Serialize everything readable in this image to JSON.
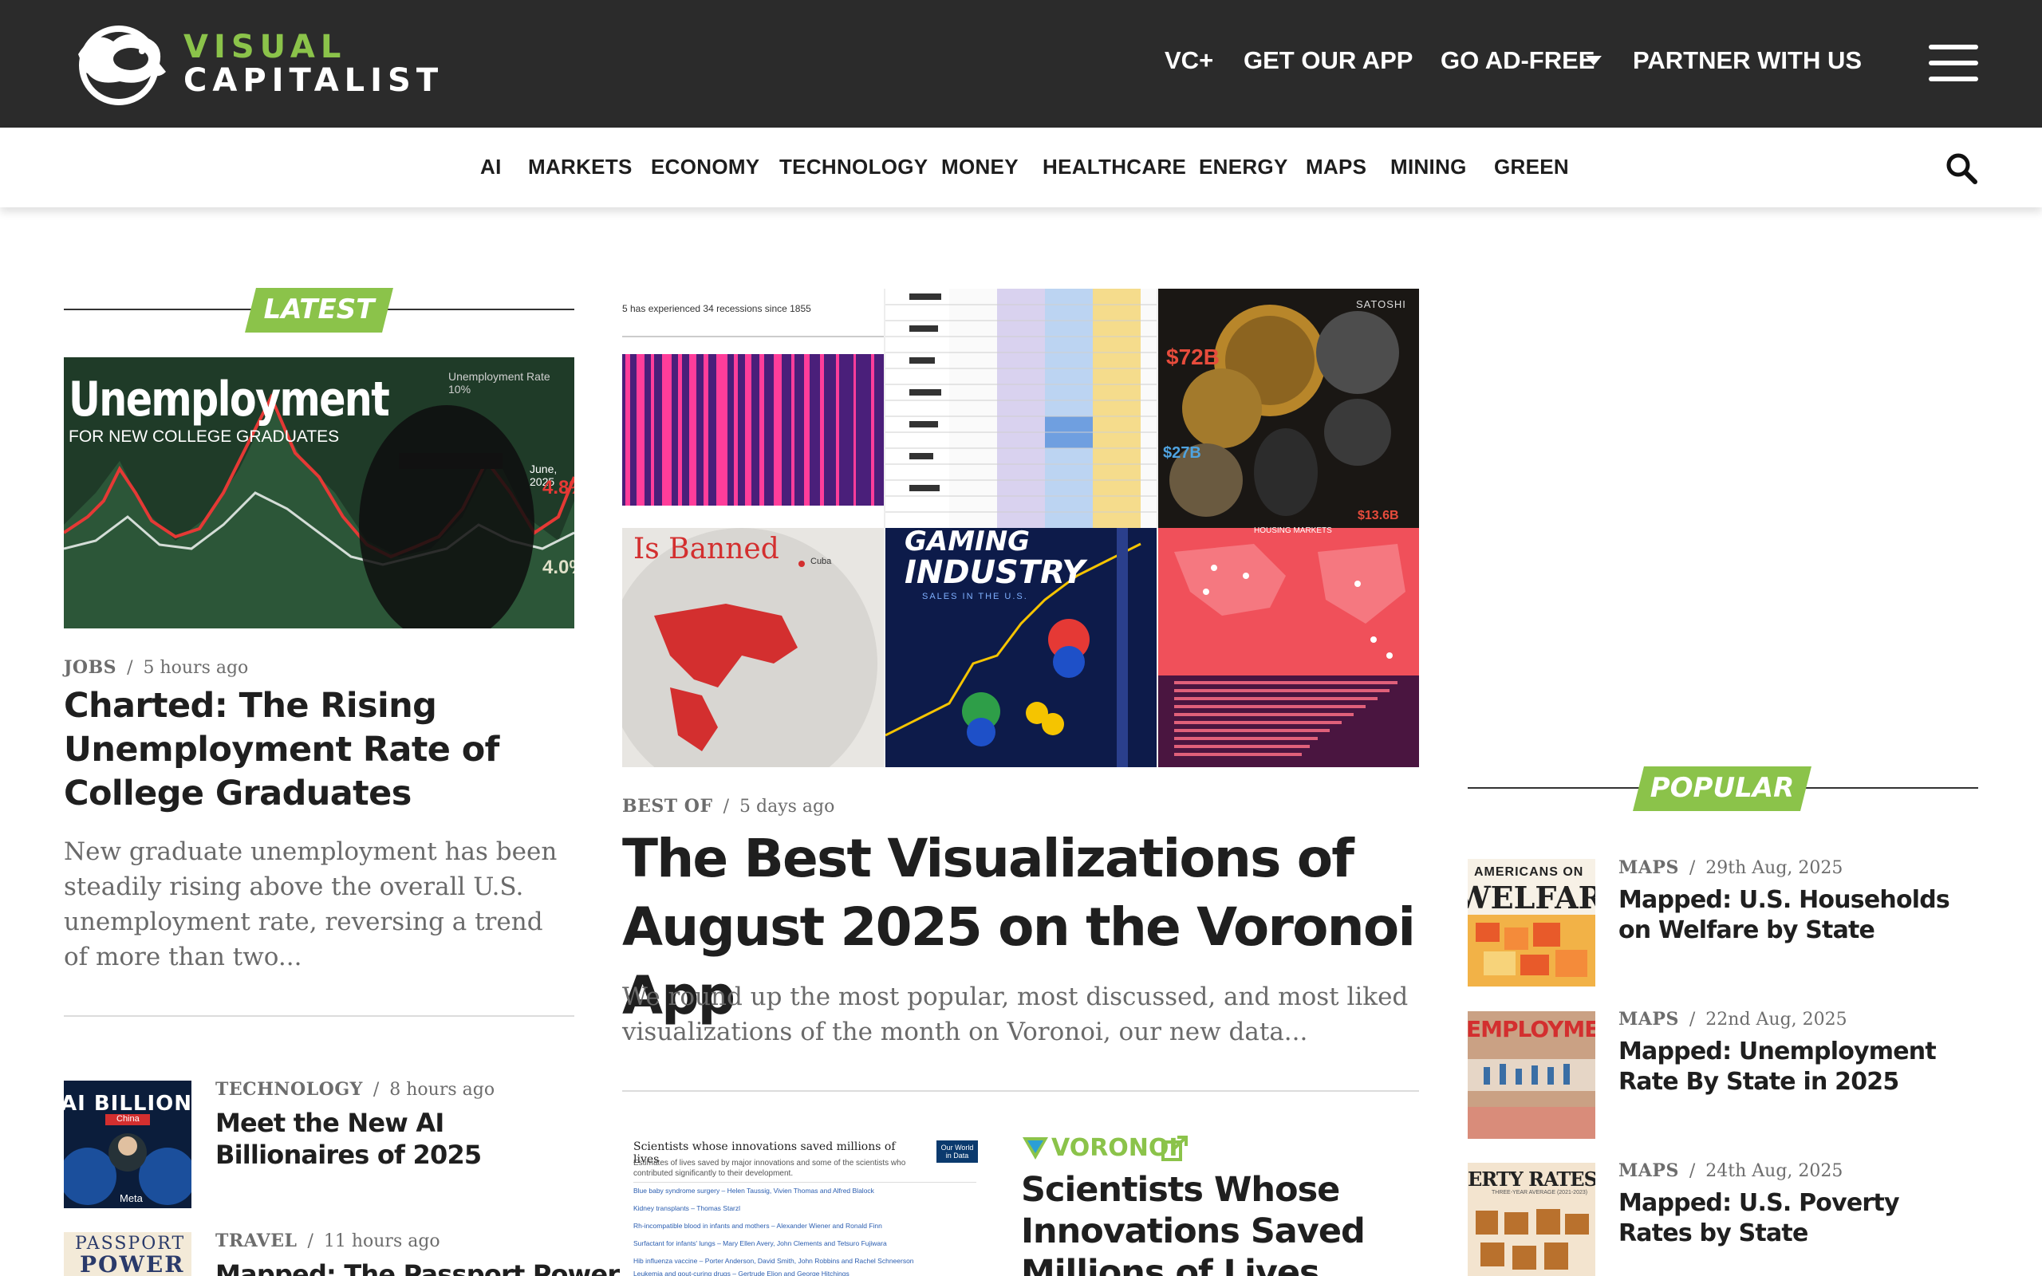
{
  "header": {
    "logo_top": "VISUAL",
    "logo_bottom": "CAPITALIST",
    "nav": [
      {
        "label": "VC+"
      },
      {
        "label": "GET OUR APP"
      },
      {
        "label": "GO AD-FREE"
      },
      {
        "label": "PARTNER WITH US"
      }
    ]
  },
  "categories": [
    "AI",
    "MARKETS",
    "ECONOMY",
    "TECHNOLOGY",
    "MONEY",
    "HEALTHCARE",
    "ENERGY",
    "MAPS",
    "MINING",
    "GREEN"
  ],
  "latest": {
    "label": "LATEST",
    "featured": {
      "image_title": "Unemployment",
      "image_subtitle": "FOR NEW COLLEGE GRADUATES",
      "image_legend": "Unemployment Rate 10%",
      "image_date": "June, 2025",
      "image_value_high": "4.8%",
      "image_value_low": "4.0%",
      "category": "JOBS",
      "time": "5 hours ago",
      "title": "Charted: The Rising Unemployment Rate of College Graduates",
      "excerpt": "New graduate unemployment has been steadily rising above the overall U.S. unemployment rate, reversing a trend of more than two..."
    },
    "items": [
      {
        "category": "TECHNOLOGY",
        "time": "8 hours ago",
        "title": "Meet the New AI Billionaires of 2025",
        "thumb_text": "AI BILLIONAIRE",
        "thumb_text2": "China",
        "thumb_text3": "Meta"
      },
      {
        "category": "TRAVEL",
        "time": "11 hours ago",
        "title": "Mapped: The Passport Power of",
        "thumb_text": "PASSPORT",
        "thumb_text2": "POWER"
      }
    ]
  },
  "main": {
    "collage": {
      "tile1_caption": "5 has experienced 34 recessions since 1855",
      "tile3_label": "SATOSHI",
      "tile3_value1": "$72B",
      "tile3_value2": "$27B",
      "tile3_value3": "$13.6B",
      "tile4_title": "Is Banned",
      "tile4_country": "Cuba",
      "tile5_title1": "GAMING",
      "tile5_title2": "INDUSTRY",
      "tile5_sub": "SALES IN THE U.S.",
      "tile6_title": "HOUSING MARKETS"
    },
    "category": "BEST OF",
    "time": "5 days ago",
    "title": "The Best Visualizations of August 2025 on the Voronoi App",
    "excerpt": "We round up the most popular, most discussed, and most liked visualizations of the month on Voronoi, our new data...",
    "voronoi": {
      "chart_title": "Scientists whose innovations saved millions of lives",
      "chart_desc": "Estimates of lives saved by major innovations and some of the scientists who contributed significantly to their development.",
      "chart_badge": "Our World in Data",
      "chart_rows": [
        "Blue baby syndrome surgery – Helen Taussig, Vivien Thomas and Alfred Blalock",
        "Kidney transplants – Thomas Starzl",
        "Rh-incompatible blood in infants and mothers – Alexander Wiener and Ronald Finn",
        "Surfactant for infants' lungs – Mary Ellen Avery, John Clements and Tetsuro Fujiwara",
        "Hib influenza vaccine – Porter Anderson, David Smith, John Robbins and Rachel Schneerson",
        "Leukemia and gout-curing drugs – Gertrude Elion and George Hitchings"
      ],
      "brand": "VORONOI",
      "title": "Scientists Whose Innovations Saved Millions of Lives"
    }
  },
  "popular": {
    "label": "POPULAR",
    "items": [
      {
        "category": "MAPS",
        "date": "29th Aug, 2025",
        "title": "Mapped: U.S. Households on Welfare by State",
        "thumb_text": "AMERICANS ON",
        "thumb_text2": "WELFARE"
      },
      {
        "category": "MAPS",
        "date": "22nd Aug, 2025",
        "title": "Mapped: Unemployment Rate By State in 2025",
        "thumb_text": "EMPLOYMENT"
      },
      {
        "category": "MAPS",
        "date": "24th Aug, 2025",
        "title": "Mapped: U.S. Poverty Rates by State",
        "thumb_text": "ERTY RATES IN AMERI",
        "thumb_text2": "THREE-YEAR AVERAGE (2021-2023)"
      }
    ]
  },
  "colors": {
    "accent": "#8bc34a",
    "header_bg": "#2b2b2b"
  }
}
